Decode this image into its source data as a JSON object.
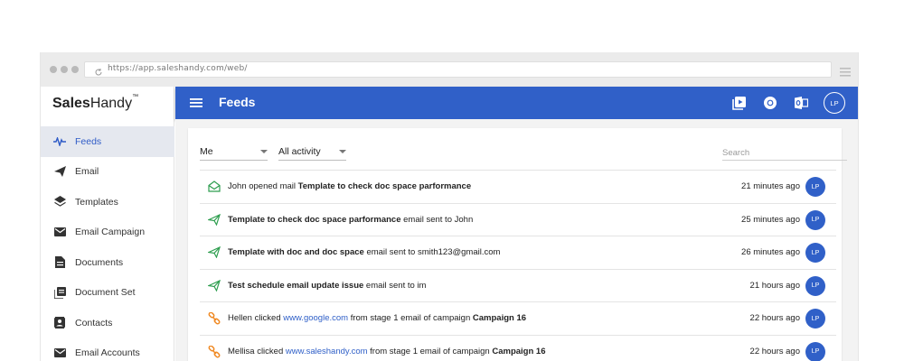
{
  "browser": {
    "url": "https://app.saleshandy.com/web/"
  },
  "brand": {
    "bold": "Sales",
    "regular": "Handy",
    "tm": "™"
  },
  "sidebar": {
    "items": [
      {
        "label": "Feeds",
        "icon": "pulse-icon",
        "active": true
      },
      {
        "label": "Email",
        "icon": "send-icon"
      },
      {
        "label": "Templates",
        "icon": "layers-icon"
      },
      {
        "label": "Email Campaign",
        "icon": "envelope-icon"
      },
      {
        "label": "Documents",
        "icon": "document-icon"
      },
      {
        "label": "Document Set",
        "icon": "document-set-icon"
      },
      {
        "label": "Contacts",
        "icon": "contacts-icon"
      },
      {
        "label": "Email Accounts",
        "icon": "envelope-icon"
      }
    ]
  },
  "header": {
    "title": "Feeds",
    "avatar": "LP"
  },
  "filters": {
    "user": "Me",
    "activity": "All activity",
    "search_placeholder": "Search"
  },
  "feed": [
    {
      "type": "open",
      "parts": {
        "pre": "John opened mail ",
        "bold": "Template to check doc space parformance"
      },
      "time": "21 minutes ago",
      "avatar": "LP"
    },
    {
      "type": "sent",
      "parts": {
        "bold": "Template to check doc space parformance",
        "post": " email sent to John"
      },
      "time": "25 minutes ago",
      "avatar": "LP"
    },
    {
      "type": "sent",
      "parts": {
        "bold": "Template with doc and doc space",
        "post": " email sent to smith123@gmail.com"
      },
      "time": "26 minutes ago",
      "avatar": "LP"
    },
    {
      "type": "sent",
      "parts": {
        "bold": "Test schedule email update issue",
        "post": " email sent to im"
      },
      "time": "21 hours ago",
      "avatar": "LP"
    },
    {
      "type": "click",
      "parts": {
        "pre": "Hellen clicked ",
        "link": "www.google.com",
        "mid": " from stage 1 email of campaign ",
        "bold2": "Campaign 16"
      },
      "time": "22 hours ago",
      "avatar": "LP"
    },
    {
      "type": "click",
      "parts": {
        "pre": "Mellisa clicked ",
        "link": "www.saleshandy.com",
        "mid": " from stage 1 email of campaign ",
        "bold2": "Campaign 16"
      },
      "time": "22 hours ago",
      "avatar": "LP"
    }
  ],
  "colors": {
    "primary": "#3060c8",
    "open": "#2e9e4f",
    "sent": "#2e9e4f",
    "click": "#f08a24"
  }
}
